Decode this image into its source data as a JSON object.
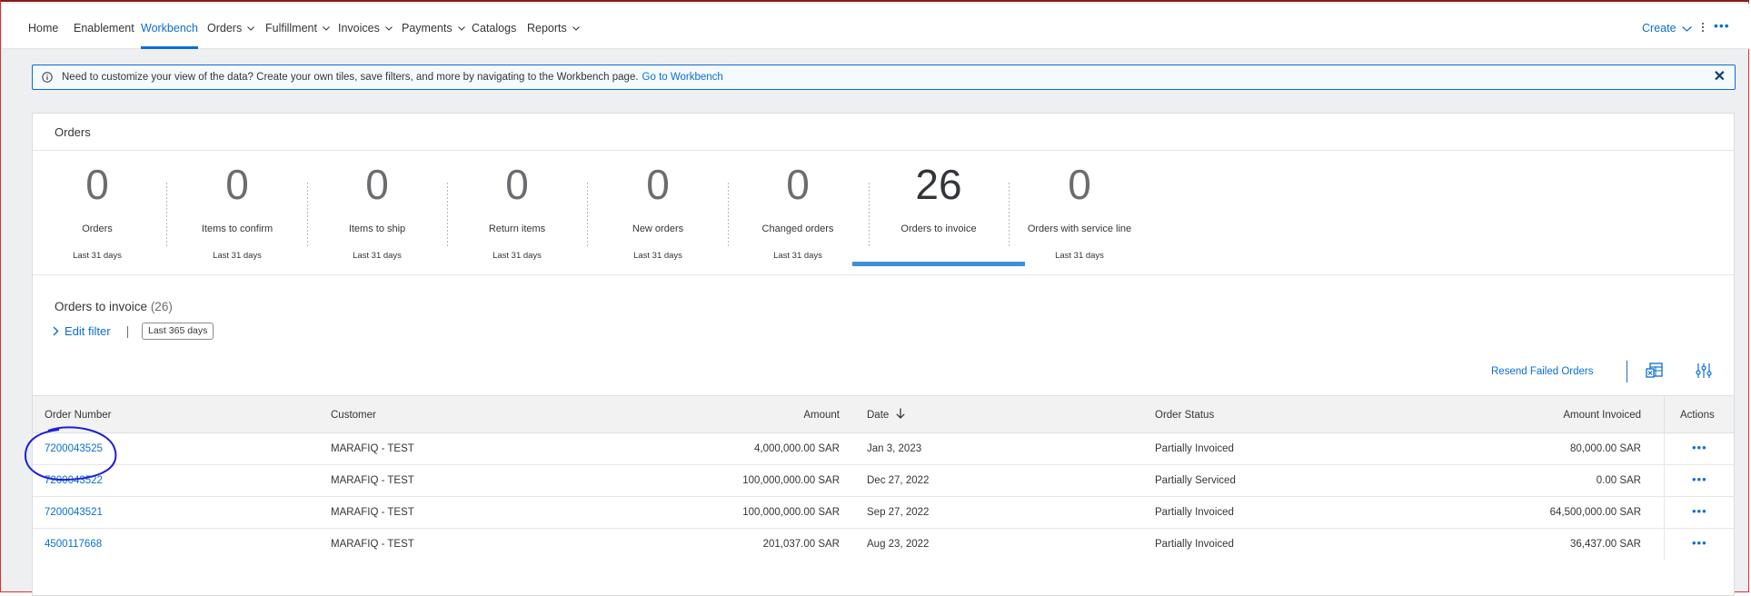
{
  "nav": {
    "items": [
      {
        "label": "Home",
        "dropdown": false
      },
      {
        "label": "Enablement",
        "dropdown": false
      },
      {
        "label": "Workbench",
        "dropdown": false,
        "active": true
      },
      {
        "label": "Orders",
        "dropdown": true
      },
      {
        "label": "Fulfillment",
        "dropdown": true
      },
      {
        "label": "Invoices",
        "dropdown": true
      },
      {
        "label": "Payments",
        "dropdown": true
      },
      {
        "label": "Catalogs",
        "dropdown": false
      },
      {
        "label": "Reports",
        "dropdown": true
      }
    ],
    "create_label": "Create",
    "more_label": "•••"
  },
  "info": {
    "text": "Need to customize your view of the data? Create your own tiles, save filters, and more by navigating to the Workbench page.",
    "link": "Go to Workbench",
    "close": "✕"
  },
  "card": {
    "title": "Orders",
    "tiles": [
      {
        "value": "0",
        "label": "Orders",
        "period": "Last 31 days"
      },
      {
        "value": "0",
        "label": "Items to confirm",
        "period": "Last 31 days"
      },
      {
        "value": "0",
        "label": "Items to ship",
        "period": "Last 31 days"
      },
      {
        "value": "0",
        "label": "Return items",
        "period": "Last 31 days"
      },
      {
        "value": "0",
        "label": "New orders",
        "period": "Last 31 days"
      },
      {
        "value": "0",
        "label": "Changed orders",
        "period": "Last 31 days"
      },
      {
        "value": "26",
        "label": "Orders to invoice",
        "period": "",
        "selected": true
      },
      {
        "value": "0",
        "label": "Orders with service line",
        "period": "Last 31 days"
      }
    ]
  },
  "section": {
    "title": "Orders to invoice",
    "count": "(26)",
    "edit_filter": "Edit filter",
    "filter_chip": "Last 365 days",
    "resend": "Resend Failed Orders"
  },
  "table": {
    "headers": {
      "order_number": "Order Number",
      "customer": "Customer",
      "amount": "Amount",
      "date": "Date",
      "order_status": "Order Status",
      "amount_invoiced": "Amount Invoiced",
      "actions": "Actions"
    },
    "rows": [
      {
        "order_number": "7200043525",
        "customer": "MARAFIQ - TEST",
        "amount": "4,000,000.00 SAR",
        "date": "Jan 3, 2023",
        "status": "Partially Invoiced",
        "invoiced": "80,000.00 SAR",
        "actions": "•••"
      },
      {
        "order_number": "7200043522",
        "customer": "MARAFIQ - TEST",
        "amount": "100,000,000.00 SAR",
        "date": "Dec 27, 2022",
        "status": "Partially Serviced",
        "invoiced": "0.00 SAR",
        "actions": "•••"
      },
      {
        "order_number": "7200043521",
        "customer": "MARAFIQ - TEST",
        "amount": "100,000,000.00 SAR",
        "date": "Sep 27, 2022",
        "status": "Partially Invoiced",
        "invoiced": "64,500,000.00 SAR",
        "actions": "•••"
      },
      {
        "order_number": "4500117668",
        "customer": "MARAFIQ - TEST",
        "amount": "201,037.00 SAR",
        "date": "Aug 23, 2022",
        "status": "Partially Invoiced",
        "invoiced": "36,437.00 SAR",
        "actions": "•••"
      }
    ]
  },
  "colors": {
    "accent": "#0a6ed1",
    "selected_tile_bar": "#3d8fdc",
    "annotation": "#1f1fd6",
    "frame": "#d9302f"
  }
}
